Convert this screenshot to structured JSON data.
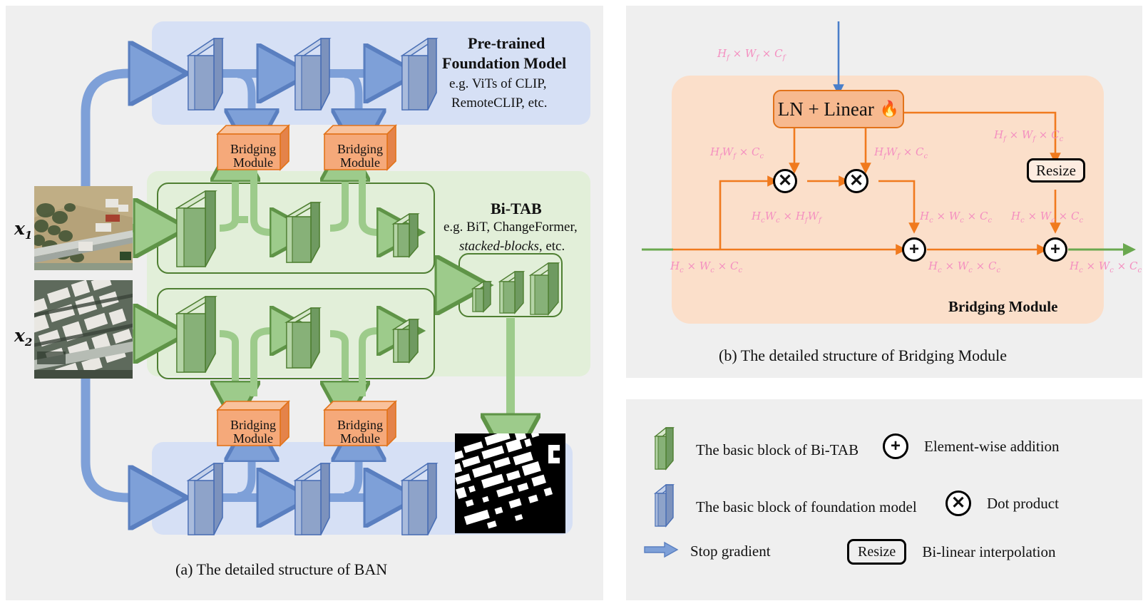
{
  "panels": {
    "a": {
      "caption": "(a) The detailed structure of BAN"
    },
    "b": {
      "caption": "(b) The detailed structure of Bridging Module",
      "module_name": "Bridging Module"
    }
  },
  "foundation_model": {
    "title_line1": "Pre-trained",
    "title_line2": "Foundation Model",
    "example_line1": "e.g. ViTs of CLIP,",
    "example_line2": "RemoteCLIP, etc.",
    "block_count": 3
  },
  "bi_tab": {
    "title": "Bi-TAB",
    "example_line1": "e.g. BiT, ChangeFormer,",
    "example_line2_italic": "stacked-blocks",
    "example_line2_tail": ", etc.",
    "block_count": 3,
    "stack_count": 3
  },
  "bridging_modules": {
    "label_line1": "Bridging",
    "label_line2": "Module",
    "count_top": 2,
    "count_bottom": 2
  },
  "inputs": {
    "image1_label": "x",
    "image1_sub": "1",
    "image2_label": "x",
    "image2_sub": "2"
  },
  "bridging_detail": {
    "ln_linear_label": "LN + Linear",
    "fire_icon": "🔥",
    "resize_label": "Resize",
    "op_mul": "✕",
    "op_add": "+",
    "dims": {
      "input": "H_f × W_f × C_f",
      "q_branch": "H_fW_f × C_c",
      "k_branch": "H_fW_f × C_c",
      "resize_in": "H_f × W_f × C_c",
      "attn": "H_cW_c × H_fW_f",
      "mul_out": "H_c × W_c × C_c",
      "resize_out": "H_c × W_c × C_c",
      "skip_in": "H_c × W_c × C_c",
      "add1_out": "H_c × W_c × C_c",
      "add2_out": "H_c × W_c × C_c"
    }
  },
  "legend": {
    "items": [
      {
        "icon": "green-slab-icon",
        "text": "The basic block of Bi-TAB"
      },
      {
        "icon": "plus-circle-icon",
        "text": "Element-wise addition",
        "symbol": "+"
      },
      {
        "icon": "blue-slab-icon",
        "text": "The basic block of foundation model"
      },
      {
        "icon": "times-circle-icon",
        "text": "Dot product",
        "symbol": "✕"
      },
      {
        "icon": "blue-arrow-icon",
        "text": "Stop gradient"
      },
      {
        "icon": "resize-box-icon",
        "text": "Bi-linear interpolation",
        "box_label": "Resize"
      }
    ]
  },
  "colors": {
    "panel_bg": "#efefef",
    "fm_band": "#d6e0f5",
    "tab_band": "#e2efd9",
    "blue_block_face": "#8ea3c9",
    "blue_block_edge": "#4a6fb5",
    "green_block_face": "#87b178",
    "green_block_edge": "#4f7f32",
    "orange_box": "#f5a97a",
    "orange_edge": "#e2731a",
    "bm_bg": "#fbdfca",
    "pink_math": "#f48fc0",
    "blue_arrow": "#7ea0d8",
    "green_arrow": "#8fc47e"
  }
}
